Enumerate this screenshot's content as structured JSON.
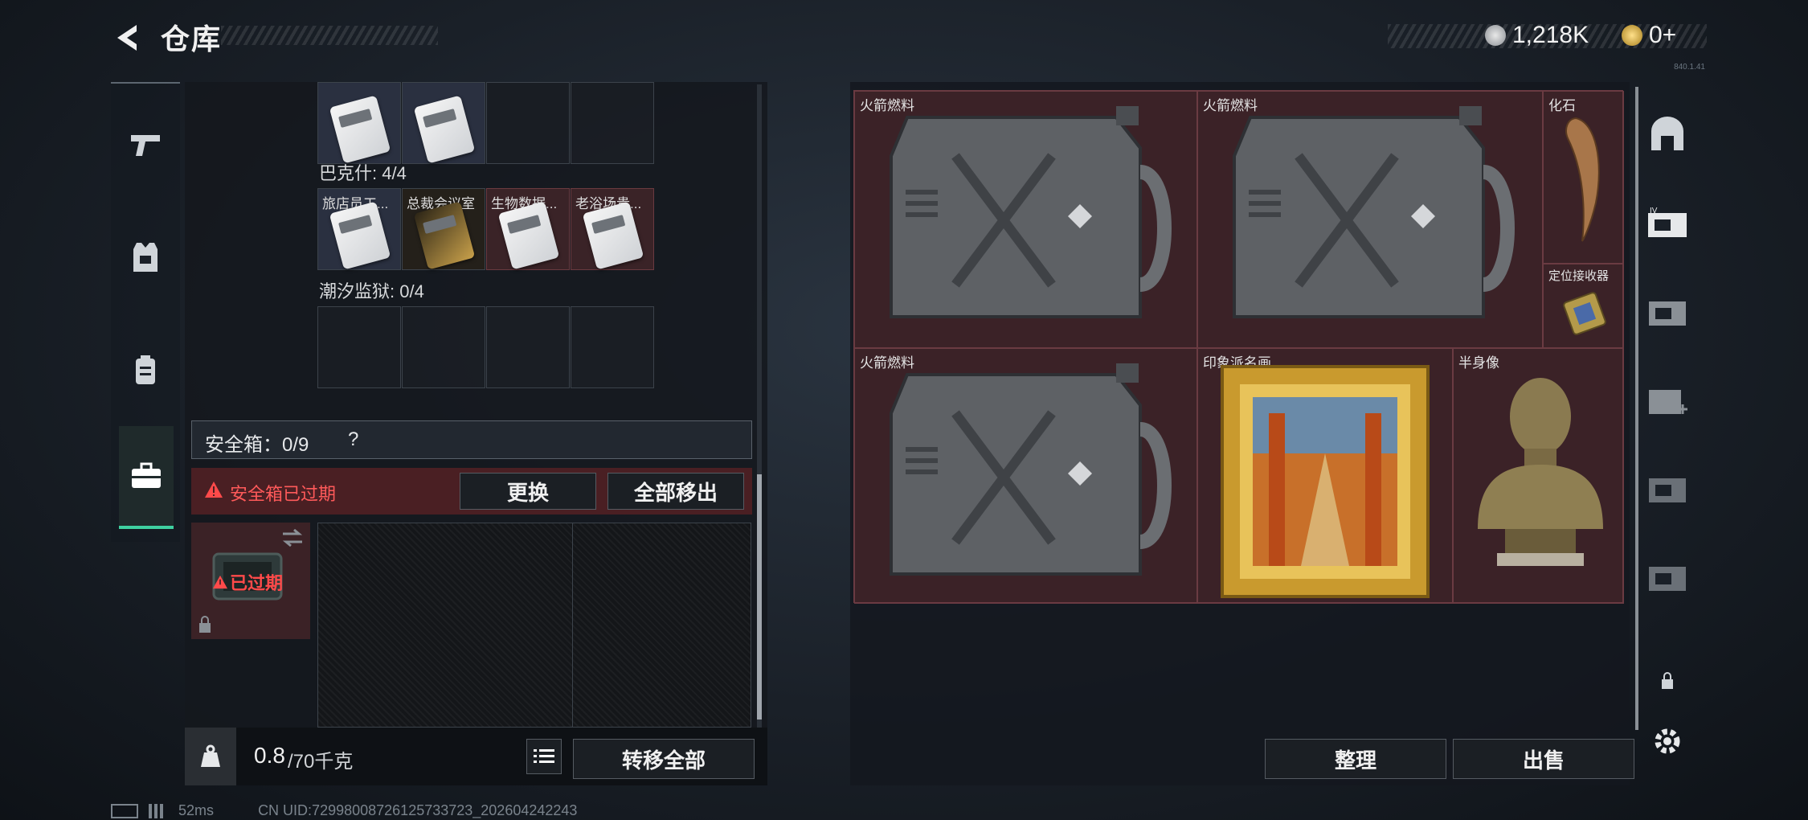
{
  "header": {
    "title": "仓库",
    "currency1": "1,218K",
    "currency2": "0+",
    "version": "840.1.41"
  },
  "colors": {
    "accent": "#3fd0a0",
    "alert": "#ff4a4a",
    "slot_red": "#3b2227"
  },
  "left": {
    "set1": {
      "label": "巴克什: 4/4"
    },
    "set2": {
      "items": [
        "旅店员工...",
        "总裁会议室",
        "生物数据...",
        "老浴场贵..."
      ]
    },
    "set3": {
      "label": "潮汐监狱: 0/4"
    },
    "safe": {
      "label": "安全箱：0/9",
      "help": "?"
    },
    "alert": {
      "text": "安全箱已过期",
      "replace": "更换",
      "move_all": "全部移出"
    },
    "expired_tag": "已过期",
    "weight_value": "0.8",
    "weight_max": "/70千克",
    "transfer_all": "转移全部"
  },
  "right": {
    "cells": [
      "火箭燃料",
      "火箭燃料",
      "化石",
      "定位接收器",
      "火箭燃料",
      "印象派名画",
      "半身像"
    ],
    "sort": "整理",
    "sell": "出售"
  },
  "footer": {
    "ping": "52ms",
    "uid": "CN UID:72998008726125733723_202604242243"
  }
}
